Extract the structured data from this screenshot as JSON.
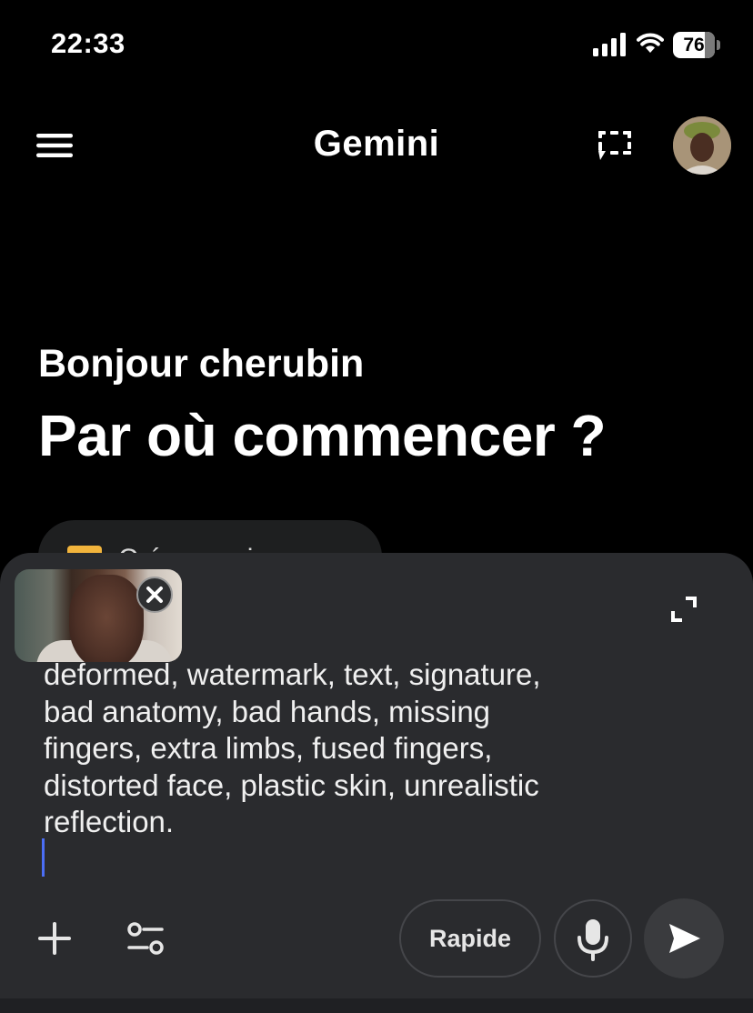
{
  "status_bar": {
    "time": "22:33",
    "battery_percent": "76",
    "battery_level": 0.76,
    "icons": [
      "signal-icon",
      "wifi-icon",
      "battery-icon"
    ]
  },
  "header": {
    "title": "Gemini",
    "icons": [
      "menu-icon",
      "new-chat-icon",
      "avatar"
    ]
  },
  "greeting": {
    "hello": "Bonjour cherubin",
    "main": "Par où commencer ?"
  },
  "suggestion": {
    "label": "Créer une image",
    "icon": "image-icon"
  },
  "composer": {
    "prompt": "deformed, watermark, text, signature,\nbad anatomy, bad hands, missing\nfingers, extra limbs, fused fingers,\ndistorted face, plastic skin, unrealistic\nreflection.",
    "attachment_icon": "remove-icon",
    "expand_icon": "expand-icon"
  },
  "toolbar": {
    "add_icon": "plus-icon",
    "tools_icon": "tune-icon",
    "mode_label": "Rapide",
    "mic_icon": "microphone-icon",
    "send_icon": "send-icon"
  },
  "colors": {
    "background": "#000000",
    "panel": "#2a2b2e",
    "cursor": "#4b6ef5",
    "text": "#ffffff"
  }
}
